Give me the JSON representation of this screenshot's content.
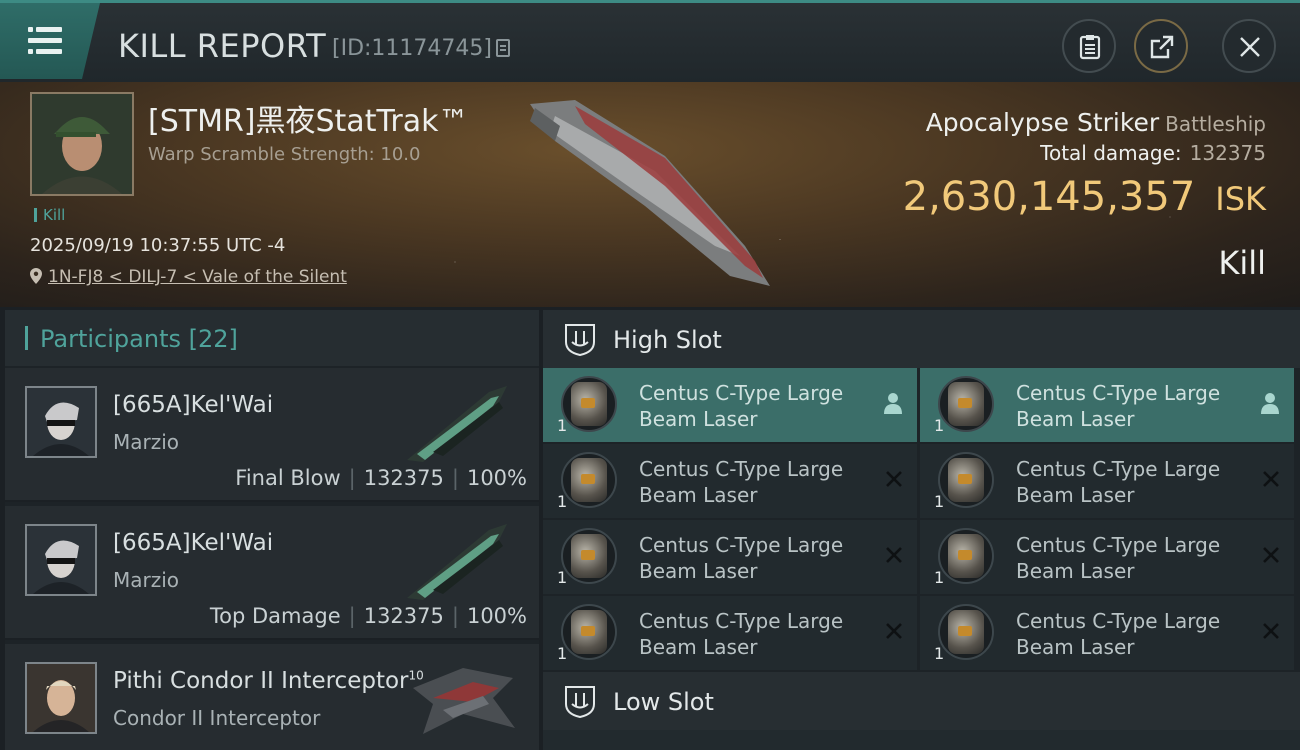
{
  "header": {
    "title": "KILL REPORT",
    "report_id": "[ID:11174745]",
    "accent": "#3d8b84"
  },
  "victim": {
    "name": "[STMR]黑夜StatTrak™",
    "warp_scramble": "Warp Scramble Strength: 10.0",
    "tag": "Kill",
    "datetime": "2025/09/19 10:37:55 UTC -4",
    "location": "1N-FJ8 < DILJ-7 < Vale of the Silent",
    "ship_name": "Apocalypse Striker",
    "ship_class": "Battleship",
    "total_damage_label": "Total damage:",
    "total_damage": "132375",
    "isk_value": "2,630,145,357",
    "isk_currency": "ISK",
    "result": "Kill"
  },
  "participants": {
    "label": "Participants",
    "count": "[22]",
    "rows": [
      {
        "name": "[665A]Kel'Wai",
        "sub": "Marzio",
        "role": "Final Blow",
        "damage": "132375",
        "percent": "100%"
      },
      {
        "name": "[665A]Kel'Wai",
        "sub": "Marzio",
        "role": "Top Damage",
        "damage": "132375",
        "percent": "100%"
      },
      {
        "name": "Pithi Condor II Interceptor",
        "sup": "10",
        "sub": "Condor II Interceptor"
      }
    ]
  },
  "slots": {
    "high_label": "High Slot",
    "low_label": "Low Slot",
    "items": [
      {
        "line1": "Centus C-Type Large",
        "line2": "Beam Laser",
        "qty": "1",
        "state": "pilot"
      },
      {
        "line1": "Centus C-Type Large",
        "line2": "Beam Laser",
        "qty": "1",
        "state": "pilot"
      },
      {
        "line1": "Centus C-Type Large",
        "line2": "Beam Laser",
        "qty": "1",
        "state": "destroyed"
      },
      {
        "line1": "Centus C-Type Large",
        "line2": "Beam Laser",
        "qty": "1",
        "state": "destroyed"
      },
      {
        "line1": "Centus C-Type Large",
        "line2": "Beam Laser",
        "qty": "1",
        "state": "destroyed"
      },
      {
        "line1": "Centus C-Type Large",
        "line2": "Beam Laser",
        "qty": "1",
        "state": "destroyed"
      },
      {
        "line1": "Centus C-Type Large",
        "line2": "Beam Laser",
        "qty": "1",
        "state": "destroyed"
      },
      {
        "line1": "Centus C-Type Large",
        "line2": "Beam Laser",
        "qty": "1",
        "state": "destroyed"
      }
    ]
  }
}
